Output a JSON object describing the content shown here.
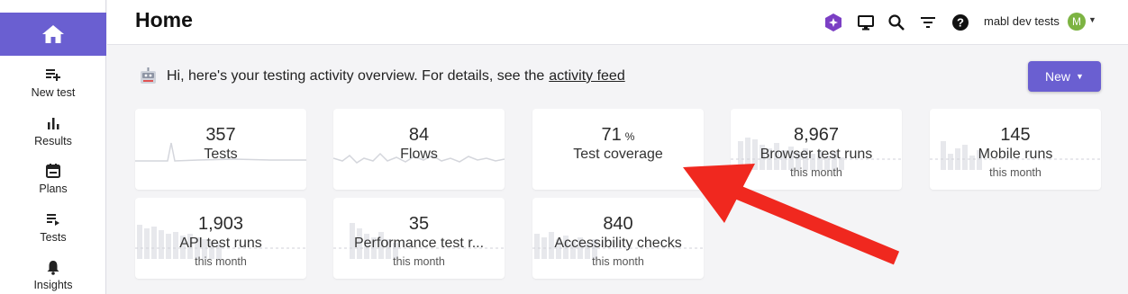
{
  "sidebar": {
    "home_label": "Home",
    "items": [
      {
        "label": "New test",
        "icon": "new-test-icon"
      },
      {
        "label": "Results",
        "icon": "bar-chart-icon"
      },
      {
        "label": "Plans",
        "icon": "calendar-icon"
      },
      {
        "label": "Tests",
        "icon": "playlist-icon"
      },
      {
        "label": "Insights",
        "icon": "bell-icon"
      }
    ]
  },
  "header": {
    "title": "Home",
    "account": "mabl dev tests",
    "avatar_initial": "M",
    "icons": [
      "ai-assistant-icon",
      "monitor-icon",
      "search-icon",
      "filter-icon",
      "help-icon"
    ]
  },
  "welcome": {
    "text": "Hi, here's your testing activity overview. For details, see the",
    "link": "activity feed"
  },
  "new_button": {
    "label": "New"
  },
  "cards": [
    {
      "value": "357",
      "label": "Tests",
      "sub": ""
    },
    {
      "value": "84",
      "label": "Flows",
      "sub": ""
    },
    {
      "value": "71",
      "unit": "%",
      "label": "Test coverage",
      "sub": ""
    },
    {
      "value": "8,967",
      "label": "Browser test runs",
      "sub": "this month"
    },
    {
      "value": "145",
      "label": "Mobile runs",
      "sub": "this month"
    },
    {
      "value": "1,903",
      "label": "API test runs",
      "sub": "this month"
    },
    {
      "value": "35",
      "label": "Performance test r...",
      "sub": "this month"
    },
    {
      "value": "840",
      "label": "Accessibility checks",
      "sub": "this month"
    }
  ],
  "colors": {
    "accent": "#6a5fd1",
    "annotation_arrow": "#f0281f",
    "avatar": "#7cb342"
  }
}
